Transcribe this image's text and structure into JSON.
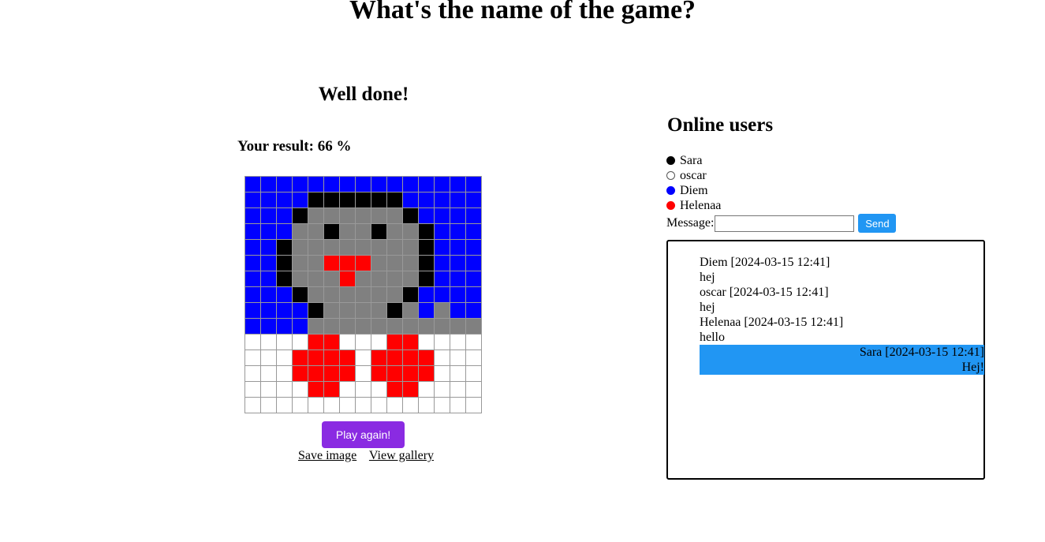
{
  "title": "What's the name of the game?",
  "game": {
    "heading": "Well done!",
    "result_label": "Your result:",
    "result_value": "66 %",
    "play_again_label": "Play again!",
    "save_image_label": "Save image",
    "view_gallery_label": "View gallery",
    "palette": {
      "B": "#0000ff",
      "K": "#000000",
      "G": "#808080",
      "R": "#ff0000",
      "W": "#ffffff"
    },
    "pixels": [
      "BBBBBBBBBBBBBBB",
      "BBBBKKKKKKBBBBB",
      "BBBKGGGGGGKBBBB",
      "BBBGGKGGKGGKBBB",
      "BBKGGGGGGGGKBBB",
      "BBKGGRRRGGGKBBB",
      "BBKGGGRGGGGKBBB",
      "BBBKGGGGGGKBBBB",
      "BBBBKGGGGKGBGBB",
      "BBBBGGGGGGGGGGG",
      "WWWWRRWWWRRWWWW",
      "WWWRRRRWRRRRWWW",
      "WWWRRRRWRRRRWWW",
      "WWWWRRWWWRRWWWW",
      "WWWWWWWWWWWWWWW"
    ]
  },
  "online": {
    "title": "Online users",
    "users": [
      {
        "name": "Sara",
        "color": "#000000"
      },
      {
        "name": "oscar",
        "color": "#ffffff"
      },
      {
        "name": "Diem",
        "color": "#0000ff"
      },
      {
        "name": "Helenaa",
        "color": "#ff0000"
      }
    ],
    "message_label": "Message:",
    "message_value": "",
    "send_label": "Send",
    "messages": [
      {
        "meta": "Diem [2024-03-15 12:41]",
        "text": "hej",
        "own": false
      },
      {
        "meta": "oscar [2024-03-15 12:41]",
        "text": "hej",
        "own": false
      },
      {
        "meta": "Helenaa [2024-03-15 12:41]",
        "text": "hello",
        "own": false
      },
      {
        "meta": "Sara [2024-03-15 12:41]",
        "text": "Hej!",
        "own": true
      }
    ]
  }
}
